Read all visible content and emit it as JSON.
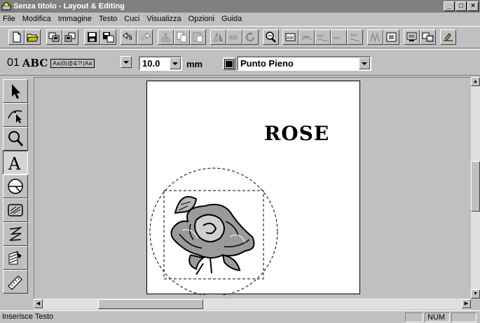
{
  "window": {
    "title": "Senza titolo - Layout & Editing"
  },
  "menu": {
    "items": [
      {
        "label": "File"
      },
      {
        "label": "Modifica"
      },
      {
        "label": "Immagine"
      },
      {
        "label": "Testo"
      },
      {
        "label": "Cuci"
      },
      {
        "label": "Visualizza"
      },
      {
        "label": "Opzioni"
      },
      {
        "label": "Guida"
      }
    ]
  },
  "text_toolbar": {
    "font_number": "01",
    "font_sample": "ABC",
    "font_variants": "Aa|0|@&?!|Aa",
    "size_value": "10.0",
    "unit": "mm",
    "thread_color": "#000000",
    "stitch_type": "Punto Pieno"
  },
  "canvas": {
    "text": "ROSE"
  },
  "statusbar": {
    "message": "Inserisce Testo",
    "num_indicator": "NUM"
  }
}
